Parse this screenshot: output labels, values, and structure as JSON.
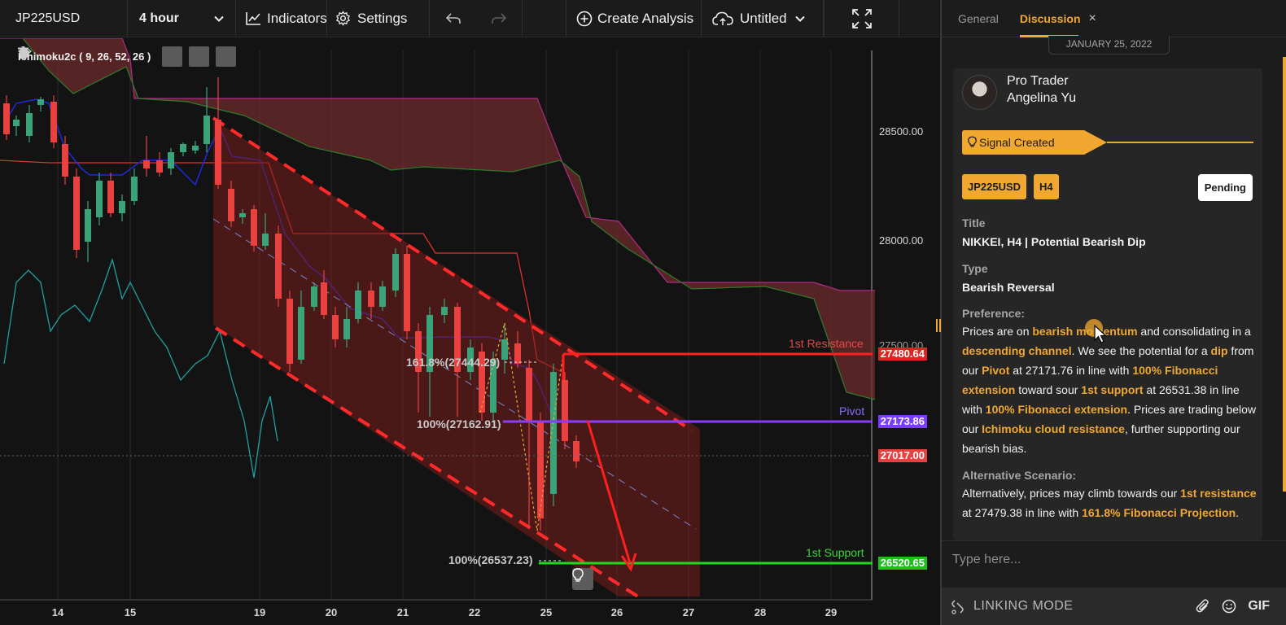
{
  "toolbar": {
    "symbol": "JP225USD",
    "interval": "4 hour",
    "indicators_label": "Indicators",
    "settings_label": "Settings",
    "create_analysis_label": "Create Analysis",
    "layout_name": "Untitled"
  },
  "chart": {
    "indicator_legend": "Ichimoku2c ( 9, 26, 52, 26 )",
    "price_axis": [
      "28500.00",
      "28000.00",
      "27500.00"
    ],
    "date_axis": [
      "14",
      "15",
      "19",
      "20",
      "21",
      "22",
      "25",
      "26",
      "27",
      "28",
      "29"
    ],
    "levels": {
      "resistance": {
        "name": "1st Resistance",
        "value": "27480.64",
        "color": "#ff1f1f"
      },
      "pivot": {
        "name": "Pivot",
        "value": "27173.86",
        "color": "#8c3cff"
      },
      "current": {
        "value": "27017.00",
        "color": "#ff4a4a"
      },
      "support": {
        "name": "1st Support",
        "value": "26520.65",
        "color": "#21d821"
      }
    },
    "fib_labels": {
      "ext_1618": "161.8%(27444.29)",
      "ext_100_upper": "100%(27162.91)",
      "ext_100_lower": "100%(26537.23)"
    },
    "colors": {
      "bull": "#3aa37a",
      "bear": "#e8413f",
      "cloud": "#6e2b2b",
      "channel": "#ff2b2b",
      "tenkan": "#2233dd",
      "chikou": "#1fa0a0"
    }
  },
  "panel": {
    "tabs": [
      "General",
      "Discussion"
    ],
    "active_tab": "Discussion",
    "date": "JANUARY 25, 2022",
    "author": {
      "role": "Pro Trader",
      "name": "Angelina Yu"
    },
    "signal_label": "Signal Created",
    "chips": {
      "symbol": "JP225USD",
      "timeframe": "H4"
    },
    "status": "Pending",
    "title_label": "Title",
    "title_value": "NIKKEI, H4 | Potential Bearish Dip",
    "type_label": "Type",
    "type_value": "Bearish Reversal",
    "preference_label": "Preference:",
    "preference_text": {
      "t1": "Prices are on ",
      "h1": "bearish momentum",
      "t2": " and consolidating in a ",
      "h2": "descending channel",
      "t3": ". We see the potential for a ",
      "h3": "dip",
      "t4": " from our ",
      "h4": "Pivot",
      "t5": " at 27171.76 in line with ",
      "h5": "100% Fibonacci extension",
      "t6": " toward sour ",
      "h6": "1st support",
      "t7": " at 26531.38 in line with ",
      "h7": "100% Fibonacci extension",
      "t8": ". Prices are trading below our ",
      "h8": "Ichimoku cloud resistance",
      "t9": ", further supporting our bearish bias."
    },
    "alternative_label": "Alternative Scenario:",
    "alternative_text": {
      "t1": "Alternatively, prices may climb towards our ",
      "h1": "1st resistance",
      "t2": " at 27479.38 in line with ",
      "h2": "161.8% Fibonacci Projection",
      "t3": "."
    },
    "compose_placeholder": "Type here...",
    "linking_mode_label": "LINKING MODE",
    "gif_label": "GIF"
  }
}
